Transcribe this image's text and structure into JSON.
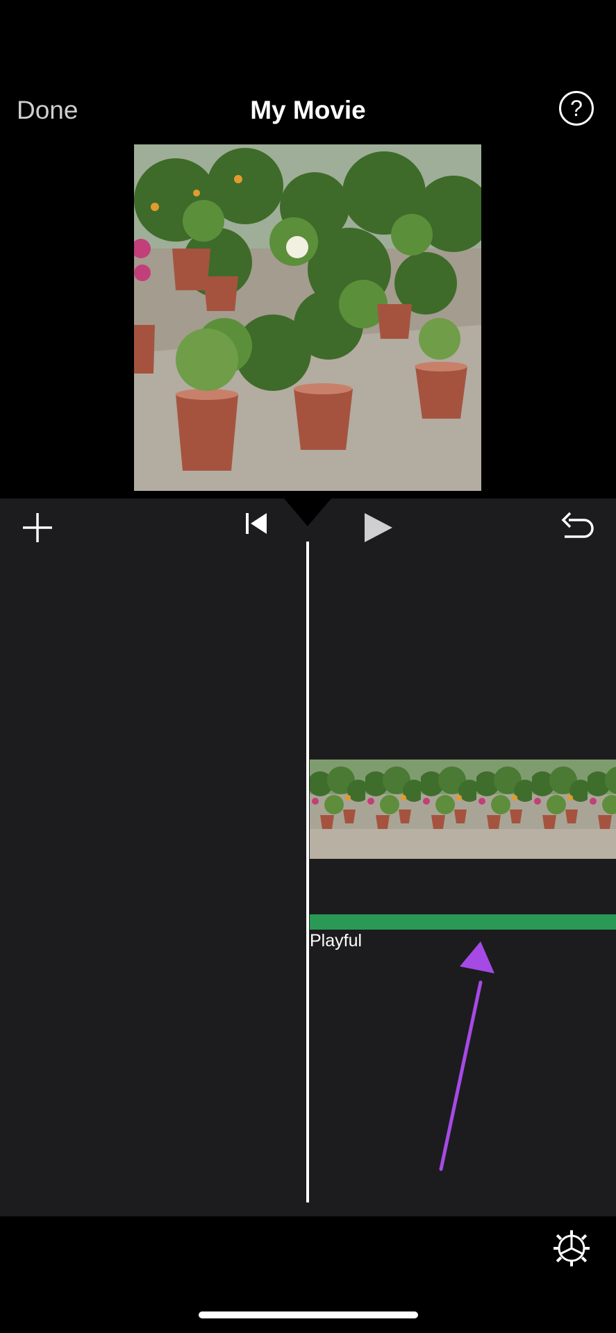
{
  "header": {
    "done_label": "Done",
    "title": "My Movie",
    "help_label": "?"
  },
  "toolbar": {
    "add_icon": "plus-icon",
    "rewind_icon": "skip-to-start-icon",
    "play_icon": "play-icon",
    "undo_icon": "undo-icon"
  },
  "timeline": {
    "music_label": "Playful",
    "music_color": "#2a9955"
  },
  "bottom": {
    "settings_icon": "gear-icon"
  },
  "colors": {
    "background": "#000000",
    "editor_bg": "#1c1c1e",
    "annotation_arrow": "#a64ae6"
  }
}
